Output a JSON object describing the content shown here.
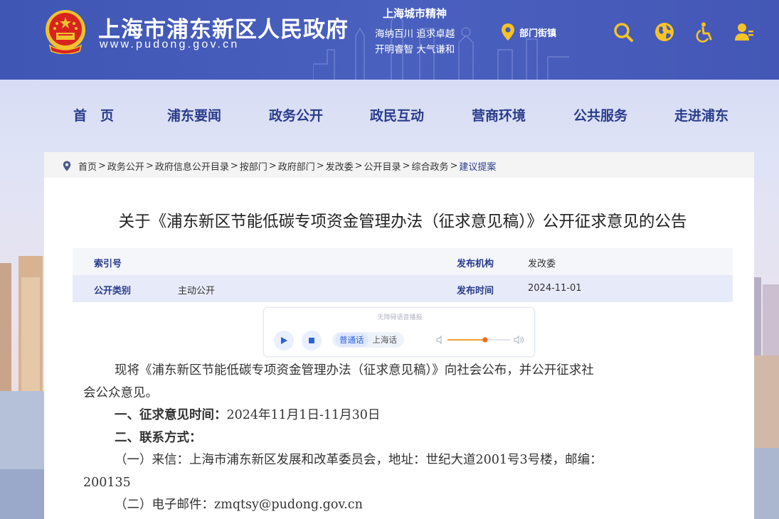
{
  "header": {
    "site_title": "上海市浦东新区人民政府",
    "site_url": "www.pudong.gov.cn",
    "spirit_title": "上海城市精神",
    "spirit_line1": "海纳百川  追求卓越",
    "spirit_line2": "开明睿智  大气谦和",
    "dept_link": "部门街镇",
    "icons": [
      "emblem-icon",
      "location-icon",
      "search-icon",
      "globe-icon",
      "accessibility-icon",
      "user-icon"
    ]
  },
  "nav": {
    "items": [
      "首　页",
      "浦东要闻",
      "政务公开",
      "政民互动",
      "营商环境",
      "公共服务",
      "走进浦东"
    ]
  },
  "breadcrumb": {
    "items": [
      "首页",
      "政务公开",
      "政府信息公开目录",
      "按部门",
      "政府部门",
      "发改委",
      "公开目录",
      "综合政务",
      "建议提案"
    ],
    "separator": ">"
  },
  "document": {
    "title": "关于《浦东新区节能低碳专项资金管理办法（征求意见稿）》公开征求意见的公告",
    "meta": {
      "index_label": "索引号",
      "index_value": "",
      "publisher_label": "发布机构",
      "publisher_value": "发改委",
      "category_label": "公开类别",
      "category_value": "主动公开",
      "date_label": "发布时间",
      "date_value": "2024-11-01"
    },
    "player": {
      "caption": "无障碍语音播报",
      "lang_active": "普通话",
      "lang_other": "上海话",
      "volume_level": 0.6
    },
    "paragraphs": {
      "p1_line1": "现将《浦东新区节能低碳专项资金管理办法（征求意见稿）》向社会公布，并公开征求社",
      "p1_line2": "会公众意见。",
      "p2_label": "一、征求意见时间：",
      "p2_value": "2024年11月1日-11月30日",
      "p3_label": "二、联系方式：",
      "p4_line1": "（一）来信：上海市浦东新区发展和改革委员会，地址：世纪大道2001号3号楼，邮编：",
      "p4_line2": "200135",
      "p5": "（二）电子邮件：zmqtsy@pudong.gov.cn"
    }
  },
  "colors": {
    "header_bg": "#4459b8",
    "nav_text": "#2a3c8c",
    "accent": "#2a61d7",
    "emblem_red": "#d8241f",
    "emblem_gold": "#f2c230",
    "icon_yellow": "#f5c325"
  }
}
